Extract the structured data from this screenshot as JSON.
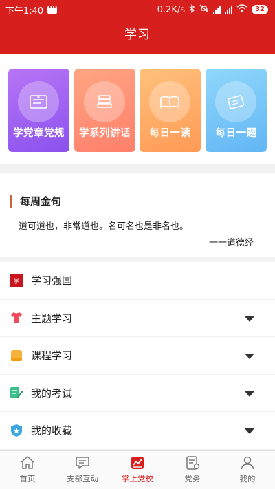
{
  "status_bar": {
    "time": "下午1:40",
    "speed": "0.2K/s",
    "battery": "32"
  },
  "header": {
    "title": "学习"
  },
  "cards": [
    {
      "label": "学党章党规"
    },
    {
      "label": "学系列讲话"
    },
    {
      "label": "每日一读"
    },
    {
      "label": "每日一题"
    }
  ],
  "quote": {
    "title": "每周金句",
    "text": "道可道也，非常道也。名可名也是非名也。",
    "source": "一一道德经"
  },
  "menu": [
    {
      "label": "学习强国",
      "icon": "xuexi-qiangguo-icon",
      "expandable": false
    },
    {
      "label": "主题学习",
      "icon": "shirt-icon",
      "expandable": true
    },
    {
      "label": "课程学习",
      "icon": "course-icon",
      "expandable": true
    },
    {
      "label": "我的考试",
      "icon": "exam-edit-icon",
      "expandable": true
    },
    {
      "label": "我的收藏",
      "icon": "favorite-shield-icon",
      "expandable": true
    }
  ],
  "tabs": [
    {
      "label": "首页",
      "icon": "home-icon"
    },
    {
      "label": "支部互动",
      "icon": "chat-icon"
    },
    {
      "label": "掌上党校",
      "icon": "school-chart-icon",
      "active": true
    },
    {
      "label": "党务",
      "icon": "party-affairs-icon"
    },
    {
      "label": "我的",
      "icon": "profile-icon"
    }
  ],
  "colors": {
    "brand_red": "#d7201e",
    "quote_bar": "#c9653a"
  }
}
